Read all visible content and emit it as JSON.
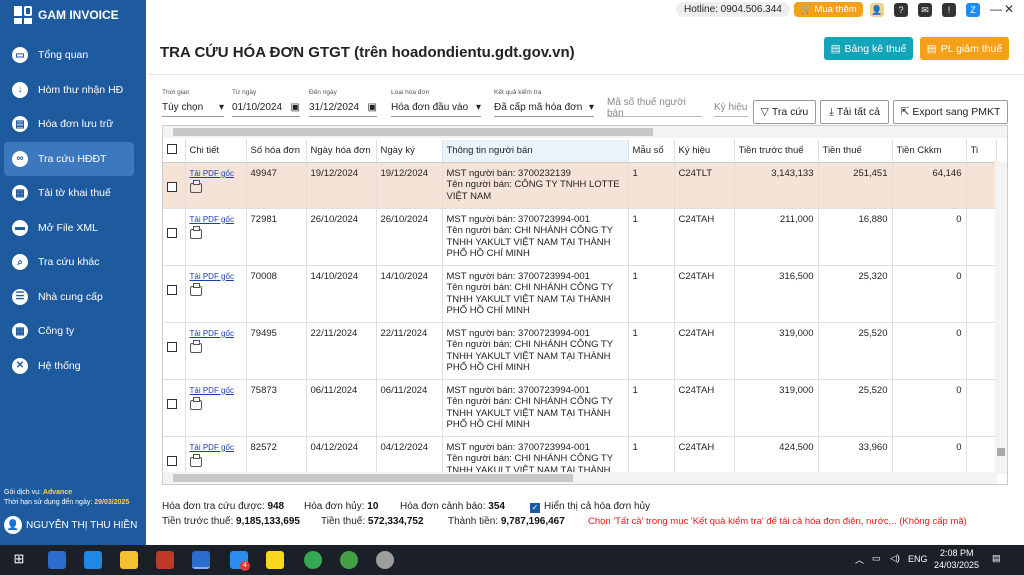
{
  "app": {
    "name": "GAM INVOICE"
  },
  "sidebar": {
    "items": [
      {
        "label": "Tổng quan",
        "icon": "monitor-icon",
        "active": false
      },
      {
        "label": "Hòm thư nhận HĐ",
        "icon": "download-icon",
        "active": false
      },
      {
        "label": "Hóa đơn lưu trữ",
        "icon": "document-icon",
        "active": false
      },
      {
        "label": "Tra cứu HĐĐT",
        "icon": "link-icon",
        "active": true
      },
      {
        "label": "Tải tờ khai thuế",
        "icon": "file-icon",
        "active": false
      },
      {
        "label": "Mở File XML",
        "icon": "folder-icon",
        "active": false
      },
      {
        "label": "Tra cứu khác",
        "icon": "search-icon",
        "active": false
      },
      {
        "label": "Nhà cung cấp",
        "icon": "contact-icon",
        "active": false
      },
      {
        "label": "Công ty",
        "icon": "building-icon",
        "active": false
      },
      {
        "label": "Hệ thống",
        "icon": "tools-icon",
        "active": false
      }
    ],
    "service_label": "Gói dịch vụ:",
    "service_value": "Advance",
    "expiry_label": "Thời hạn sử dụng đến ngày:",
    "expiry_value": "29/03/2025",
    "user_name": "NGUYỄN THỊ THU HIỀN"
  },
  "topbar": {
    "hotline": "Hotline: 0904.506.344",
    "buy": "Mua thêm"
  },
  "header": {
    "title": "TRA CỨU HÓA ĐƠN GTGT (trên hoadondientu.gdt.gov.vn)",
    "btn_tax_list": "Bảng kê thuế",
    "btn_tax_reduction": "PL giảm thuế"
  },
  "filters": {
    "period_label": "Thời gian",
    "period_value": "Tùy chọn",
    "from_label": "Từ ngày",
    "from_value": "01/10/2024",
    "to_label": "Đến ngày",
    "to_value": "31/12/2024",
    "type_label": "Loại hóa đơn",
    "type_value": "Hóa đơn đầu vào",
    "result_label": "Kết quả kiểm tra",
    "result_value": "Đã cấp mã hóa đơn",
    "seller_tax_placeholder": "Mã số thuế người bán",
    "symbol_placeholder": "Ký hiệu",
    "btn_search": "Tra cứu",
    "btn_download_all": "Tải tất cả",
    "btn_export": "Export sang PMKT"
  },
  "table": {
    "columns": [
      "Chi tiết",
      "Số hóa đơn",
      "Ngày hóa đơn",
      "Ngày ký",
      "Thông tin người bán",
      "Mẫu số",
      "Ký hiệu",
      "Tiền trước thuế",
      "Tiền thuế",
      "Tiền Ckkm",
      "Ti"
    ],
    "pdf_label": "Tải PDF gốc",
    "rows": [
      {
        "number": "49947",
        "date": "19/12/2024",
        "signed": "19/12/2024",
        "seller": "MST người bán: 3700232139\nTên người bán: CÔNG TY TNHH LOTTE VIỆT NAM",
        "form": "1",
        "symbol": "C24TLT",
        "pretax": "3,143,133",
        "tax": "251,451",
        "discount": "64,146"
      },
      {
        "number": "72981",
        "date": "26/10/2024",
        "signed": "26/10/2024",
        "seller": "MST người bán: 3700723994-001\nTên người bán: CHI NHÁNH CÔNG TY TNHH YAKULT VIỆT NAM TẠI THÀNH PHỐ HỒ CHÍ MINH",
        "form": "1",
        "symbol": "C24TAH",
        "pretax": "211,000",
        "tax": "16,880",
        "discount": "0"
      },
      {
        "number": "70008",
        "date": "14/10/2024",
        "signed": "14/10/2024",
        "seller": "MST người bán: 3700723994-001\nTên người bán: CHI NHÁNH CÔNG TY TNHH YAKULT VIỆT NAM TẠI THÀNH PHỐ HỒ CHÍ MINH",
        "form": "1",
        "symbol": "C24TAH",
        "pretax": "316,500",
        "tax": "25,320",
        "discount": "0"
      },
      {
        "number": "79495",
        "date": "22/11/2024",
        "signed": "22/11/2024",
        "seller": "MST người bán: 3700723994-001\nTên người bán: CHI NHÁNH CÔNG TY TNHH YAKULT VIỆT NAM TẠI THÀNH PHỐ HỒ CHÍ MINH",
        "form": "1",
        "symbol": "C24TAH",
        "pretax": "319,000",
        "tax": "25,520",
        "discount": "0"
      },
      {
        "number": "75873",
        "date": "06/11/2024",
        "signed": "06/11/2024",
        "seller": "MST người bán: 3700723994-001\nTên người bán: CHI NHÁNH CÔNG TY TNHH YAKULT VIỆT NAM TẠI THÀNH PHỐ HỒ CHÍ MINH",
        "form": "1",
        "symbol": "C24TAH",
        "pretax": "319,000",
        "tax": "25,520",
        "discount": "0"
      },
      {
        "number": "82572",
        "date": "04/12/2024",
        "signed": "04/12/2024",
        "seller": "MST người bán: 3700723994-001\nTên người bán: CHI NHÁNH CÔNG TY TNHH YAKULT VIỆT NAM TẠI THÀNH",
        "form": "1",
        "symbol": "C24TAH",
        "pretax": "424,500",
        "tax": "33,960",
        "discount": "0"
      }
    ]
  },
  "summary": {
    "found_label": "Hóa đơn tra cứu được:",
    "found_value": "948",
    "cancel_label": "Hóa đơn hủy:",
    "cancel_value": "10",
    "warn_label": "Hóa đơn cảnh báo:",
    "warn_value": "354",
    "show_cancel_label": "Hiển thị cả hóa đơn hủy",
    "pretax_label": "Tiền trước thuế:",
    "pretax_value": "9,185,133,695",
    "tax_label": "Tiền thuế:",
    "tax_value": "572,334,752",
    "total_label": "Thành tiền:",
    "total_value": "9,787,196,467",
    "note": "Chọn 'Tất cả' trong mục 'Kết quả kiểm tra' để tải cả hóa đơn điện, nước,.. (Không cấp mã)"
  },
  "taskbar": {
    "lang": "ENG",
    "time": "2:08 PM",
    "date": "24/03/2025",
    "badge": "4"
  }
}
